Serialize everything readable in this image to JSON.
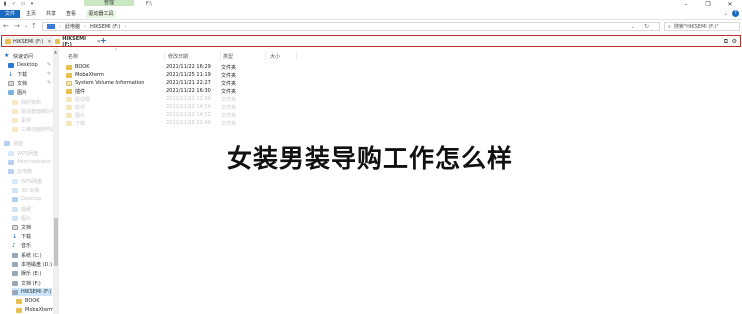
{
  "titlebar": {
    "context_tab": "管理",
    "path": "F:\\",
    "window_controls": [
      "minimize",
      "restore",
      "close"
    ]
  },
  "ribbon": {
    "tabs": [
      "文件",
      "主页",
      "共享",
      "查看",
      "驱动器工具"
    ]
  },
  "address": {
    "crumbs": [
      "此电脑",
      "HIKSEMI (F:)"
    ],
    "search_placeholder": "搜索\"HIKSEMI (F:)\""
  },
  "tabbar": {
    "tabs": [
      {
        "label": "HIKSEMI (F:)"
      },
      {
        "label": "HIKSEMI (F:)"
      }
    ],
    "add": "+"
  },
  "nav": {
    "items": [
      {
        "label": "快速访问",
        "icon": "star-icon"
      },
      {
        "label": "Desktop",
        "icon": "desktop-icon"
      },
      {
        "label": "下载",
        "icon": "download-icon"
      },
      {
        "label": "文档",
        "icon": "document-icon"
      },
      {
        "label": "图片",
        "icon": "pictures-icon"
      },
      {
        "label": "我的资料",
        "icon": "folder-icon"
      },
      {
        "label": "驱动表面细分析",
        "icon": "folder-icon"
      },
      {
        "label": "素材",
        "icon": "folder-icon"
      },
      {
        "label": "三维动画制作品",
        "icon": "folder-icon"
      },
      {
        "label": "桌面",
        "icon": "desktop-icon"
      },
      {
        "label": "WPS网盘",
        "icon": "cloud-icon"
      },
      {
        "label": "Administrator",
        "icon": "user-icon"
      },
      {
        "label": "此电脑",
        "icon": "pc-icon"
      },
      {
        "label": "WPS网盘",
        "icon": "cloud-icon"
      },
      {
        "label": "3D 对象",
        "icon": "3d-icon"
      },
      {
        "label": "Desktop",
        "icon": "desktop-icon"
      },
      {
        "label": "视频",
        "icon": "video-icon"
      },
      {
        "label": "图片",
        "icon": "pictures-icon"
      },
      {
        "label": "文档",
        "icon": "document-icon"
      },
      {
        "label": "下载",
        "icon": "download-icon"
      },
      {
        "label": "音乐",
        "icon": "music-icon"
      },
      {
        "label": "系统 (C:)",
        "icon": "drive-icon"
      },
      {
        "label": "本地磁盘 (D:)",
        "icon": "drive-icon"
      },
      {
        "label": "娱乐 (E:)",
        "icon": "drive-icon"
      },
      {
        "label": "文档 (F:)",
        "icon": "drive-icon"
      },
      {
        "label": "HIKSEMI (F:)",
        "icon": "drive-icon"
      },
      {
        "label": "BOOK",
        "icon": "folder-icon"
      },
      {
        "label": "MobaXterm",
        "icon": "folder-icon"
      }
    ]
  },
  "content": {
    "columns": [
      "名称",
      "修改日期",
      "类型",
      "大小"
    ],
    "rows": [
      {
        "name": "BOOK",
        "date": "2021/11/22 16:29",
        "type": "文件夹"
      },
      {
        "name": "MobaXterm",
        "date": "2021/11/25 11:19",
        "type": "文件夹"
      },
      {
        "name": "System Volume Information",
        "date": "2021/11/21 22:27",
        "type": "文件夹"
      },
      {
        "name": "插件",
        "date": "2021/11/22 16:30",
        "type": "文件夹"
      },
      {
        "name": "驱动程",
        "date": "2021/11/22 22:00",
        "type": "文件夹"
      },
      {
        "name": "软件",
        "date": "2021/11/22 14:54",
        "type": "文件夹"
      },
      {
        "name": "图片",
        "date": "2021/11/22 14:52",
        "type": "文件夹"
      },
      {
        "name": "下载",
        "date": "2021/11/26 22:40",
        "type": "文件夹"
      }
    ]
  },
  "caption": "女装男装导购工作怎么样"
}
